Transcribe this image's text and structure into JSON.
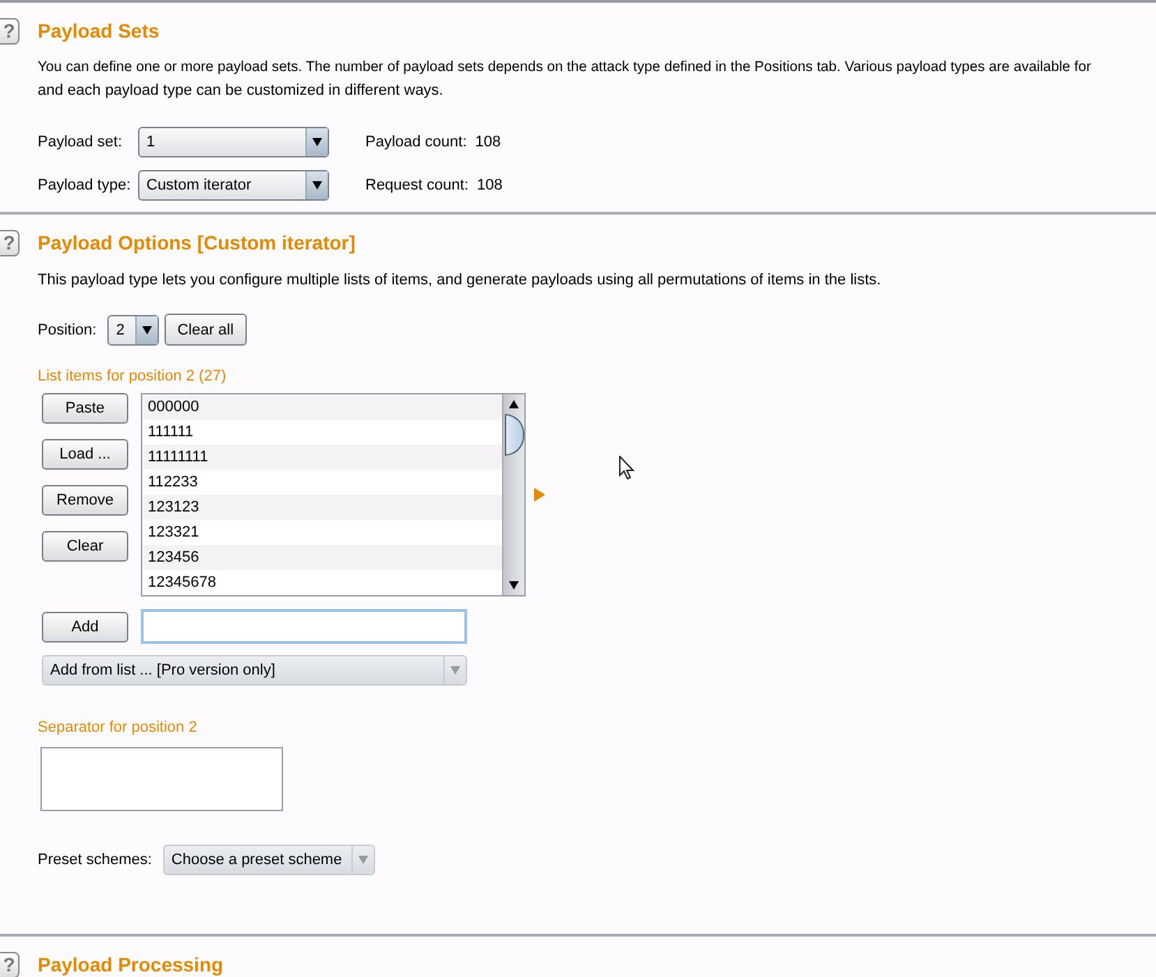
{
  "payload_sets": {
    "help_icon": "?",
    "title": "Payload Sets",
    "description": "You can define one or more payload sets. The number of payload sets depends on the attack type defined in the Positions tab. Various payload types are available for",
    "description_line2": "and each payload type can be customized in different ways.",
    "fields": [
      {
        "label": "Payload set:",
        "value": "1",
        "info_label": "Payload count:",
        "info_value": "108"
      },
      {
        "label": "Payload type:",
        "value": "Custom iterator",
        "info_label": "Request count:",
        "info_value": "108"
      }
    ]
  },
  "payload_options": {
    "help_icon": "?",
    "title": "Payload Options [Custom iterator]",
    "description": "This payload type lets you configure multiple lists of items, and generate payloads using all permutations of items in the lists.",
    "position": {
      "label": "Position:",
      "value": "2",
      "clear_button": "Clear all"
    },
    "list_label": "List items for position 2 (27)",
    "list_buttons": [
      "Paste",
      "Load ...",
      "Remove",
      "Clear"
    ],
    "list_items": [
      "000000",
      "111111",
      "11111111",
      "112233",
      "123123",
      "123321",
      "123456",
      "12345678"
    ],
    "add_button": "Add",
    "add_from_list": {
      "value": "Add from list ... [Pro version only]",
      "disabled": true
    },
    "separator_label": "Separator for position 2",
    "preset": {
      "label": "Preset schemes:",
      "placeholder": "Choose a preset scheme"
    }
  },
  "payload_processing": {
    "help_icon": "?",
    "title": "Payload Processing"
  }
}
